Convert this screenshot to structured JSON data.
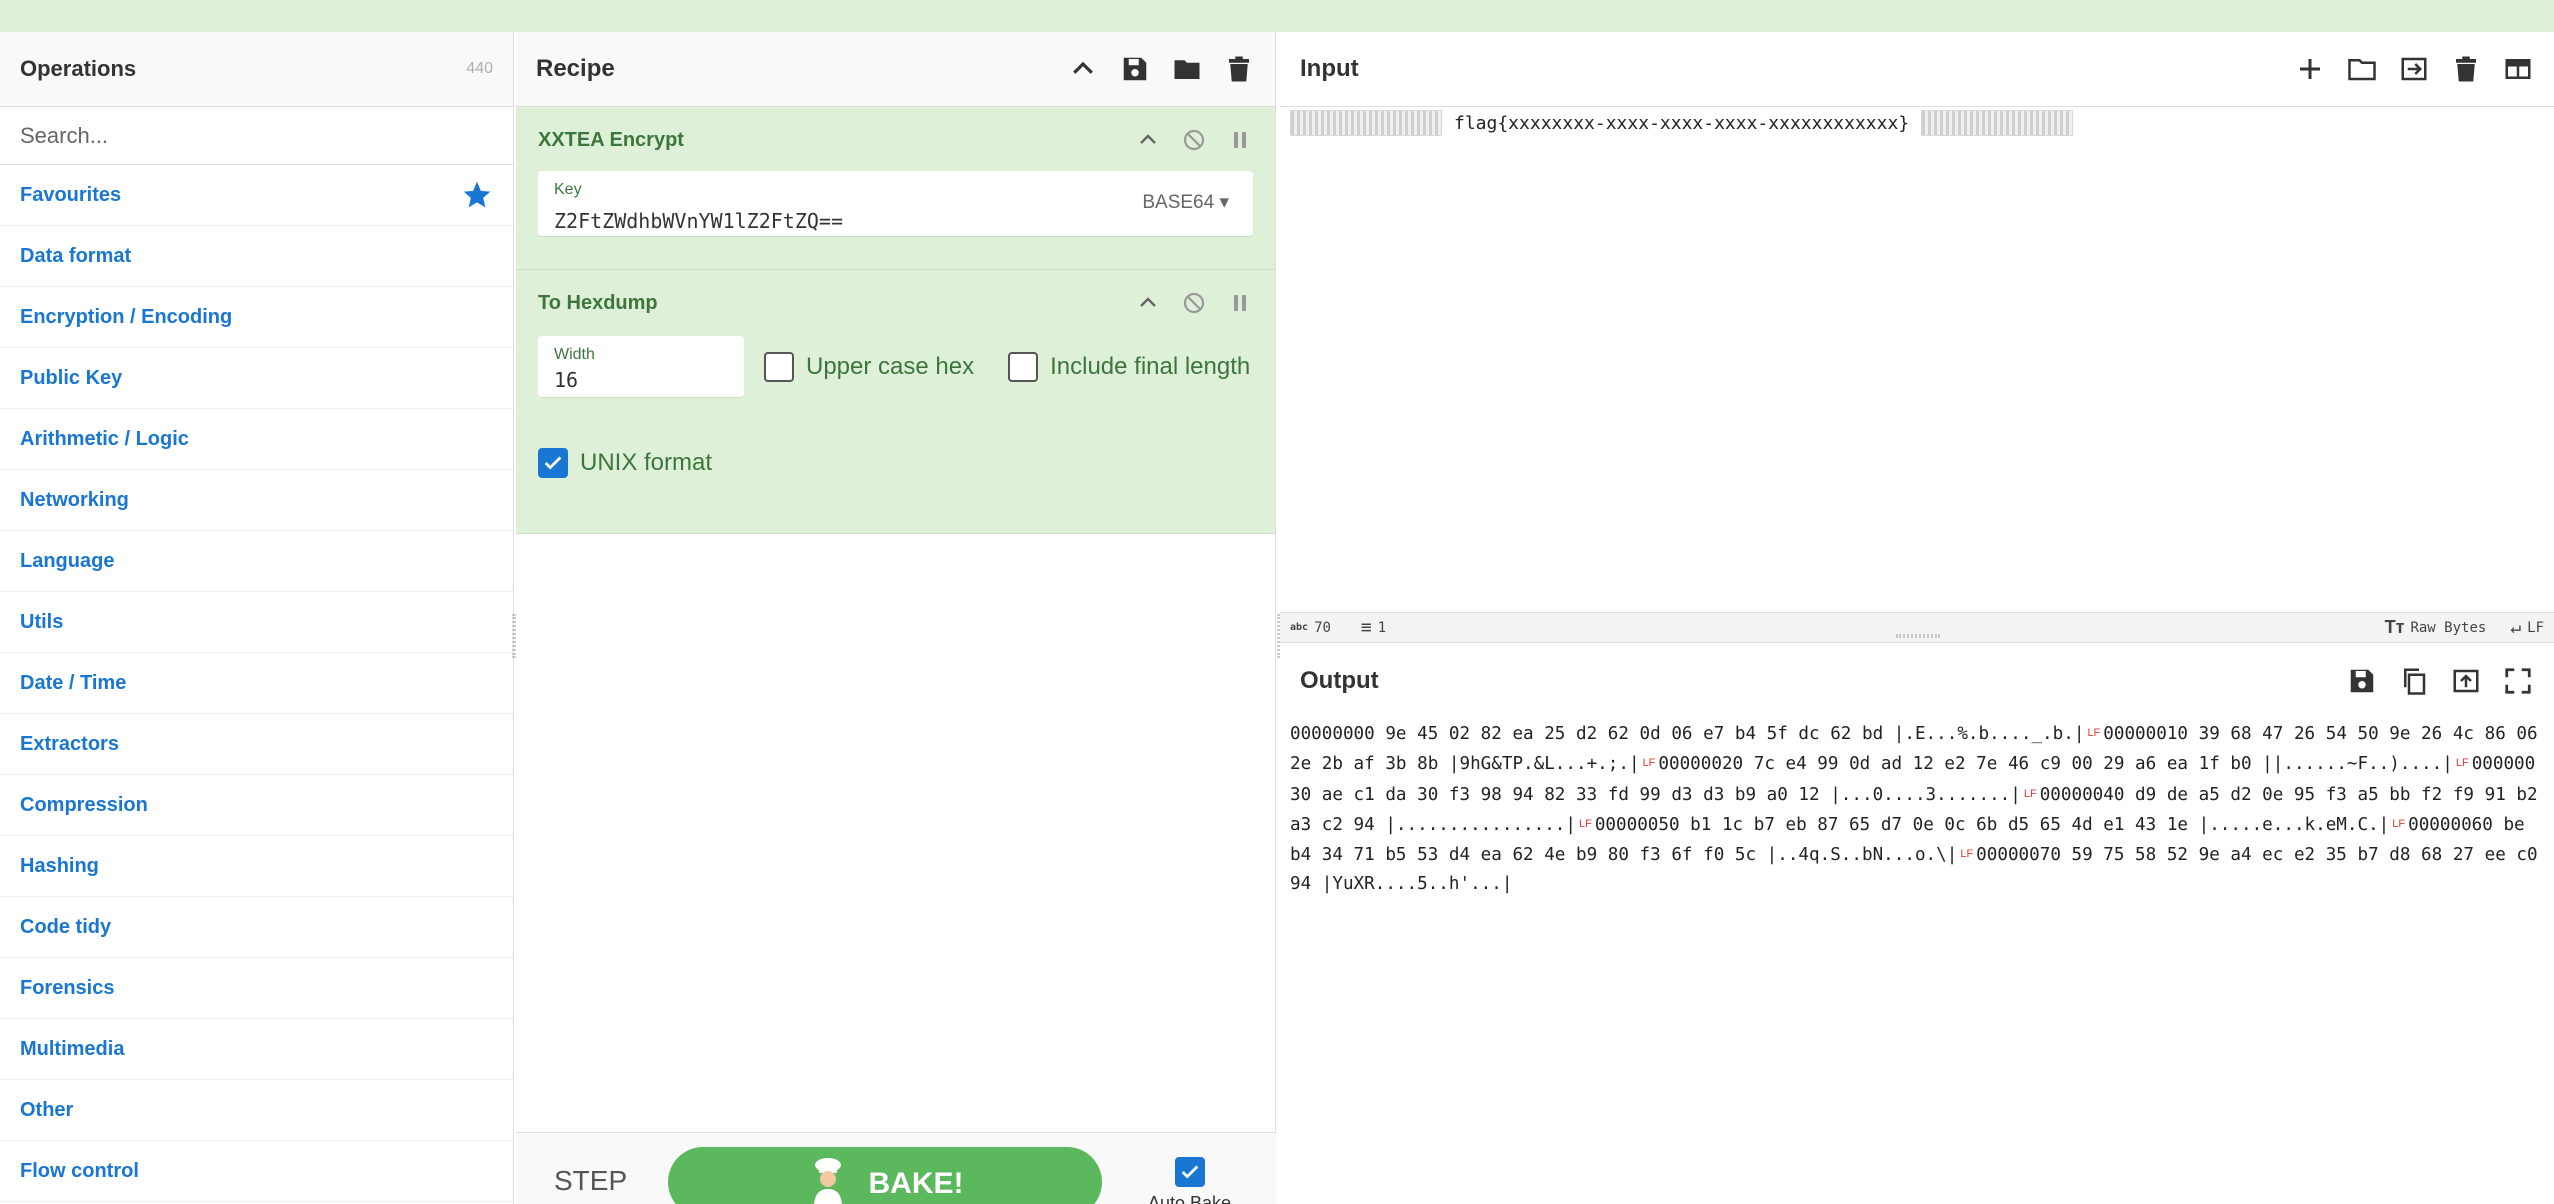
{
  "operations": {
    "title": "Operations",
    "count": "440",
    "search_placeholder": "Search...",
    "categories": [
      "Favourites",
      "Data format",
      "Encryption / Encoding",
      "Public Key",
      "Arithmetic / Logic",
      "Networking",
      "Language",
      "Utils",
      "Date / Time",
      "Extractors",
      "Compression",
      "Hashing",
      "Code tidy",
      "Forensics",
      "Multimedia",
      "Other",
      "Flow control"
    ]
  },
  "recipe": {
    "title": "Recipe",
    "icons": [
      "chevron-up-icon",
      "save-icon",
      "folder-icon",
      "trash-icon"
    ],
    "ops": [
      {
        "name": "XXTEA Encrypt",
        "key_label": "Key",
        "key_value": "Z2FtZWdhbWVnYW1lZ2FtZQ==",
        "key_format": "BASE64"
      },
      {
        "name": "To Hexdump",
        "width_label": "Width",
        "width_value": "16",
        "upper_case_hex_label": "Upper case hex",
        "upper_case_hex": false,
        "include_final_length_label": "Include final length",
        "include_final_length": false,
        "unix_format_label": "UNIX format",
        "unix_format": true
      }
    ],
    "step_label": "STEP",
    "bake_label": "BAKE!",
    "auto_bake_label": "Auto Bake",
    "auto_bake": true
  },
  "input": {
    "title": "Input",
    "icons": [
      "plus-icon",
      "folder-icon",
      "import-icon",
      "trash-icon",
      "layout-icon"
    ],
    "text": "flag{xxxxxxxx-xxxx-xxxx-xxxx-xxxxxxxxxxxx}",
    "status": {
      "abc_label": "abc",
      "length": "70",
      "lines": "1",
      "encoding": "Raw Bytes",
      "eol": "LF"
    }
  },
  "output": {
    "title": "Output",
    "icons": [
      "save-icon",
      "copy-icon",
      "replace-input-icon",
      "maximise-icon"
    ],
    "lf_marker": "LF",
    "lines": [
      "00000000 9e 45 02 82 ea 25 d2 62 0d 06 e7 b4 5f dc 62 bd |.E...%.b...._.b.|",
      "00000010 39 68 47 26 54 50 9e 26 4c 86 06 2e 2b af 3b 8b |9hG&TP.&L...+.;.|",
      "00000020 7c e4 99 0d ad 12 e2 7e 46 c9 00 29 a6 ea 1f b0 ||......~F..)....|",
      "00000030 ae c1 da 30 f3 98 94 82 33 fd 99 d3 d3 b9 a0 12 |...0....3.......|",
      "00000040 d9 de a5 d2 0e 95 f3 a5 bb f2 f9 91 b2 a3 c2 94 |................|",
      "00000050 b1 1c b7 eb 87 65 d7 0e 0c 6b d5 65 4d e1 43 1e |.....e...k.eM.C.|",
      "00000060 be b4 34 71 b5 53 d4 ea 62 4e b9 80 f3 6f f0 5c |..4q.S..bN...o.\\|",
      "00000070 59 75 58 52 9e a4 ec e2 35 b7 d8 68 27 ee c0 94 |YuXR....5..h'...|"
    ]
  },
  "colors": {
    "accent_blue": "#1976d2",
    "recipe_green_bg": "#dff0d8",
    "recipe_green_text": "#3c763d",
    "bake_green": "#5cb85c",
    "lf_red": "#e53935"
  }
}
